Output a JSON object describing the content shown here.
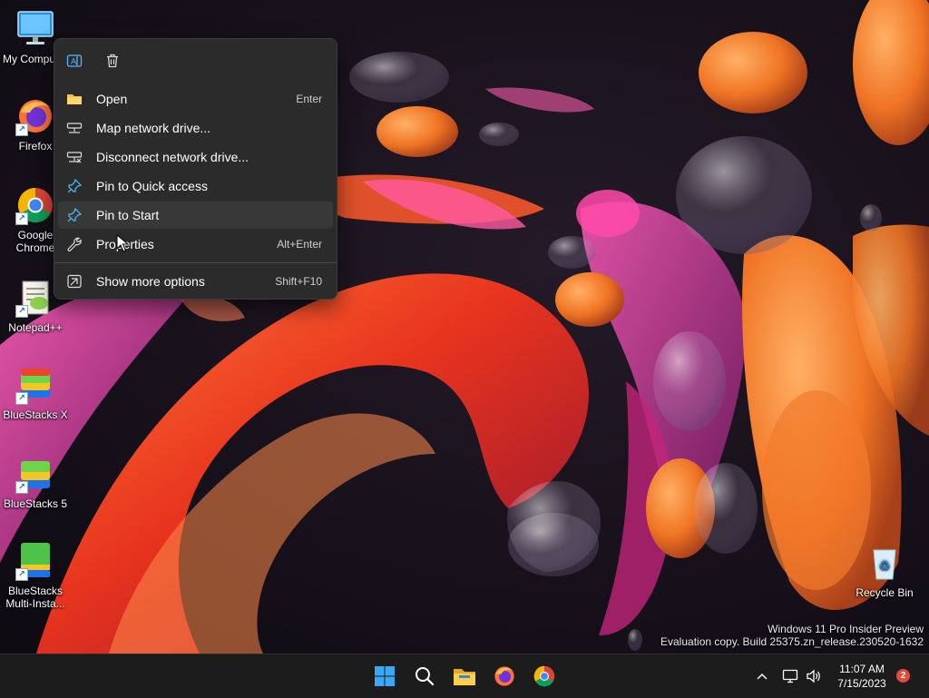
{
  "desktop": {
    "icons": [
      {
        "label": "My Computer",
        "icon": "monitor-icon"
      },
      {
        "label": "Firefox",
        "icon": "firefox-icon"
      },
      {
        "label": "Google Chrome",
        "icon": "chrome-icon"
      },
      {
        "label": "Notepad++",
        "icon": "notepadpp-icon"
      },
      {
        "label": "BlueStacks X",
        "icon": "bluestacks-x-icon"
      },
      {
        "label": "BlueStacks 5",
        "icon": "bluestacks-5-icon"
      },
      {
        "label": "BlueStacks Multi-Insta...",
        "icon": "bluestacks-multi-icon"
      },
      {
        "label": "Recycle Bin",
        "icon": "recycle-bin-icon"
      }
    ]
  },
  "context_menu": {
    "quick_actions": [
      {
        "icon": "rename-icon"
      },
      {
        "icon": "delete-icon"
      }
    ],
    "items": [
      {
        "label": "Open",
        "shortcut": "Enter",
        "icon": "folder-icon"
      },
      {
        "label": "Map network drive...",
        "shortcut": "",
        "icon": "network-drive-icon"
      },
      {
        "label": "Disconnect network drive...",
        "shortcut": "",
        "icon": "disconnect-drive-icon"
      },
      {
        "label": "Pin to Quick access",
        "shortcut": "",
        "icon": "pin-icon"
      },
      {
        "label": "Pin to Start",
        "shortcut": "",
        "icon": "pin-icon"
      },
      {
        "label": "Properties",
        "shortcut": "Alt+Enter",
        "icon": "wrench-icon"
      },
      {
        "label": "Show more options",
        "shortcut": "Shift+F10",
        "icon": "more-options-icon"
      }
    ],
    "hovered_item": "Pin to Start"
  },
  "watermark": {
    "line1": "Windows 11 Pro Insider Preview",
    "line2": "Evaluation copy. Build 25375.zn_release.230520-1632"
  },
  "taskbar": {
    "apps": [
      "start-icon",
      "search-icon",
      "file-explorer-icon",
      "firefox-icon",
      "chrome-icon"
    ],
    "time": "11:07 AM",
    "date": "7/15/2023",
    "notification_count": "2"
  },
  "colors": {
    "menu_bg": "#2b2b2b",
    "taskbar_bg": "#1c1c1c",
    "accent": "#4cc2ff"
  }
}
